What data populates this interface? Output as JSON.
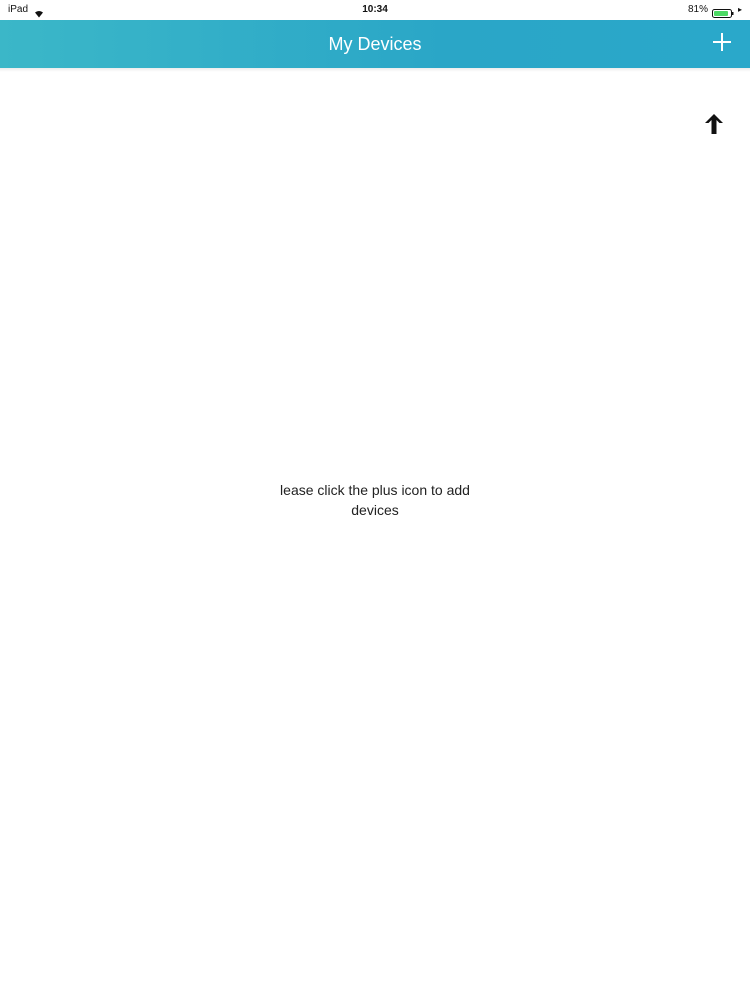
{
  "status_bar": {
    "carrier": "iPad",
    "time": "10:34",
    "battery_percent": "81%",
    "wifi_icon": "wifi-icon",
    "battery_icon": "battery-icon",
    "battery_color": "#4cd964"
  },
  "nav": {
    "title": "My Devices",
    "add_icon": "plus-icon",
    "accent_color": "#2aa6c7"
  },
  "hint": {
    "arrow_icon": "arrow-up-icon"
  },
  "empty_state": {
    "line1": "lease click the plus icon to add",
    "line2": "devices"
  }
}
